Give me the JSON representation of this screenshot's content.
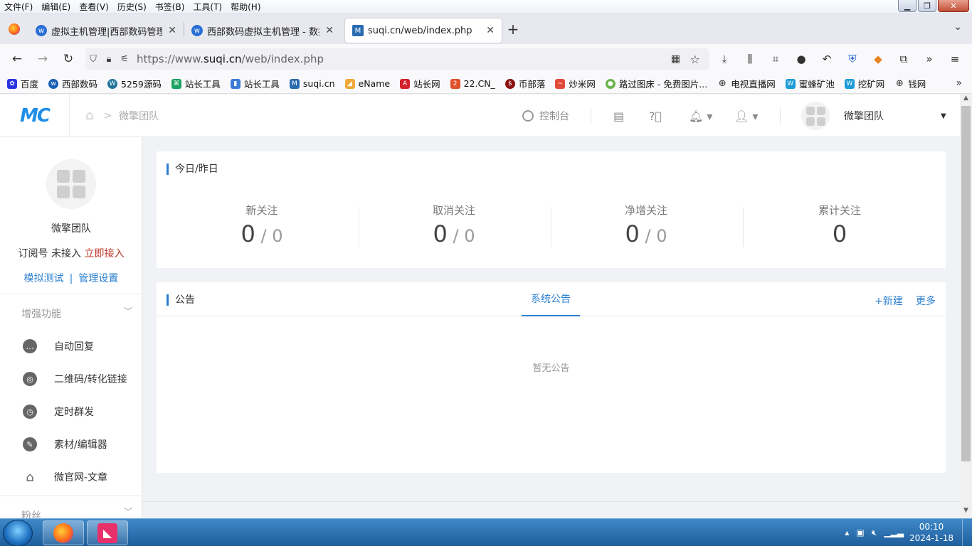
{
  "browser": {
    "menu": [
      "文件(F)",
      "编辑(E)",
      "查看(V)",
      "历史(S)",
      "书签(B)",
      "工具(T)",
      "帮助(H)"
    ],
    "tabs": [
      {
        "title": "虚拟主机管理|西部数码管理中心"
      },
      {
        "title": "西部数码虚拟主机管理 - 数据库"
      },
      {
        "title": "suqi.cn/web/index.php"
      }
    ],
    "url_prefix": "https://www.",
    "url_domain": "suqi.cn",
    "url_path": "/web/index.php",
    "bookmarks": [
      "百度",
      "西部数码",
      "5259源码",
      "站长工具",
      "站长工具",
      "suqi.cn",
      "eName",
      "站长网",
      "22.CN_",
      "币部落",
      "炒米网",
      "路过图床 - 免费图片...",
      "电视直播网",
      "蜜蜂矿池",
      "挖矿网",
      "钱网"
    ]
  },
  "header": {
    "logo": "MC",
    "breadcrumb": "微擎团队",
    "console": "控制台",
    "account_name": "微擎团队"
  },
  "sidebar": {
    "name": "微擎团队",
    "sub_type": "订阅号",
    "sub_status": "未接入",
    "sub_action": "立即接入",
    "link_test": "模拟测试",
    "link_manage": "管理设置",
    "section_enhanced": "增强功能",
    "items": [
      {
        "label": "自动回复",
        "icon": "chat-bubble-icon"
      },
      {
        "label": "二维码/转化链接",
        "icon": "qrcode-link-icon"
      },
      {
        "label": "定时群发",
        "icon": "clock-send-icon"
      },
      {
        "label": "素材/编辑器",
        "icon": "pencil-icon"
      },
      {
        "label": "微官网-文章",
        "icon": "home-icon"
      }
    ],
    "section_fans": "粉丝"
  },
  "stats": {
    "title": "今日/昨日",
    "items": [
      {
        "label": "新关注",
        "today": "0",
        "yesterday": "0"
      },
      {
        "label": "取消关注",
        "today": "0",
        "yesterday": "0"
      },
      {
        "label": "净增关注",
        "today": "0",
        "yesterday": "0"
      },
      {
        "label": "累计关注",
        "today": "0"
      }
    ]
  },
  "notice": {
    "title": "公告",
    "tab": "系统公告",
    "new": "+新建",
    "more": "更多",
    "empty": "暂无公告"
  },
  "taskbar": {
    "time": "00:10",
    "date": "2024-1-18"
  }
}
